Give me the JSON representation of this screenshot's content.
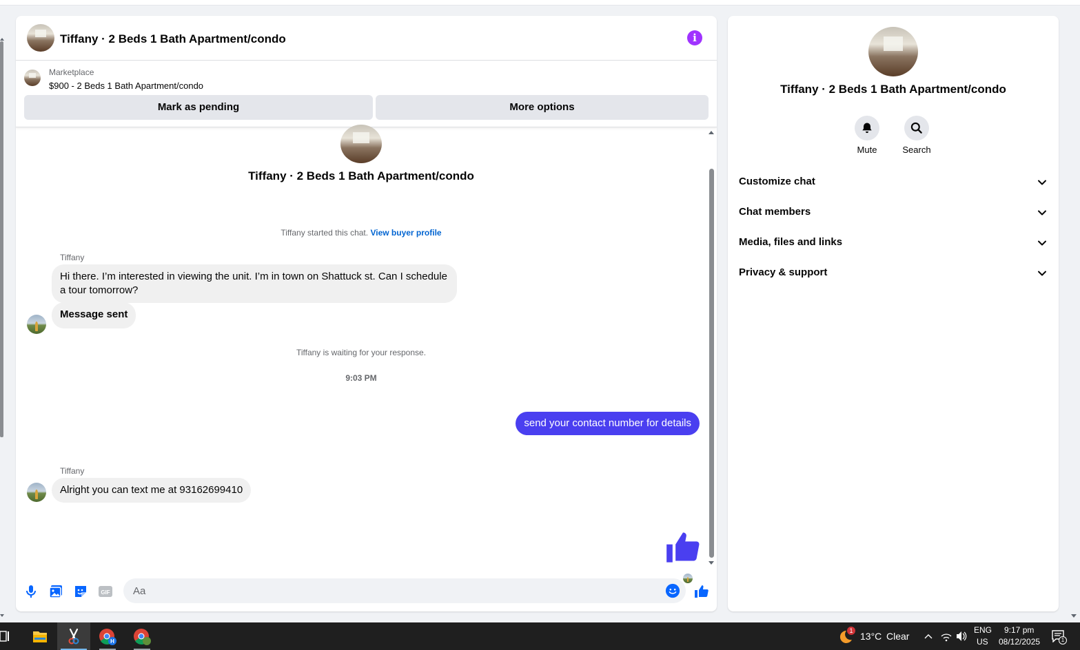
{
  "conversation": {
    "title": "Tiffany · 2 Beds 1 Bath Apartment/condo"
  },
  "listing": {
    "source": "Marketplace",
    "title": "$900 - 2 Beds 1 Bath Apartment/condo",
    "mark_pending_label": "Mark as pending",
    "more_options_label": "More options"
  },
  "messages": {
    "intro_title": "Tiffany · 2 Beds 1 Bath Apartment/condo",
    "started_text": "Tiffany started this chat.",
    "view_profile_link": "View buyer profile",
    "m1_sender": "Tiffany",
    "m1_text": "Hi there. I’m interested in viewing the unit. I’m in town on Shattuck st. Can I schedule a tour tomorrow?",
    "m2_text": "Message sent",
    "waiting_text": "Tiffany is waiting for your response.",
    "timestamp": "9:03 PM",
    "m3_text": "send your contact number for details",
    "m4_sender": "Tiffany",
    "m4_text": "Alright you can text me at 93162699410"
  },
  "composer": {
    "placeholder": "Aa"
  },
  "info_panel": {
    "title": "Tiffany · 2 Beds 1 Bath Apartment/condo",
    "mute_label": "Mute",
    "search_label": "Search",
    "sections": [
      "Customize chat",
      "Chat members",
      "Media, files and links",
      "Privacy & support"
    ]
  },
  "taskbar": {
    "weather_temp": "13°C",
    "weather_cond": "Clear",
    "weather_badge": "1",
    "lang_top": "ENG",
    "lang_bottom": "US",
    "time": "9:17 pm",
    "date": "08/12/2025",
    "notification_count": "1",
    "chrome_profile_letter": "H"
  },
  "colors": {
    "accent": "#4a3ff0",
    "messenger_blue": "#0866ff",
    "info_purple": "#a033ff",
    "link": "#0064d1"
  },
  "icons": [
    "info-icon",
    "microphone-icon",
    "photo-icon",
    "sticker-icon",
    "gif-icon",
    "emoji-icon",
    "thumbs-up-icon",
    "bell-icon",
    "search-icon",
    "chevron-down-icon"
  ]
}
